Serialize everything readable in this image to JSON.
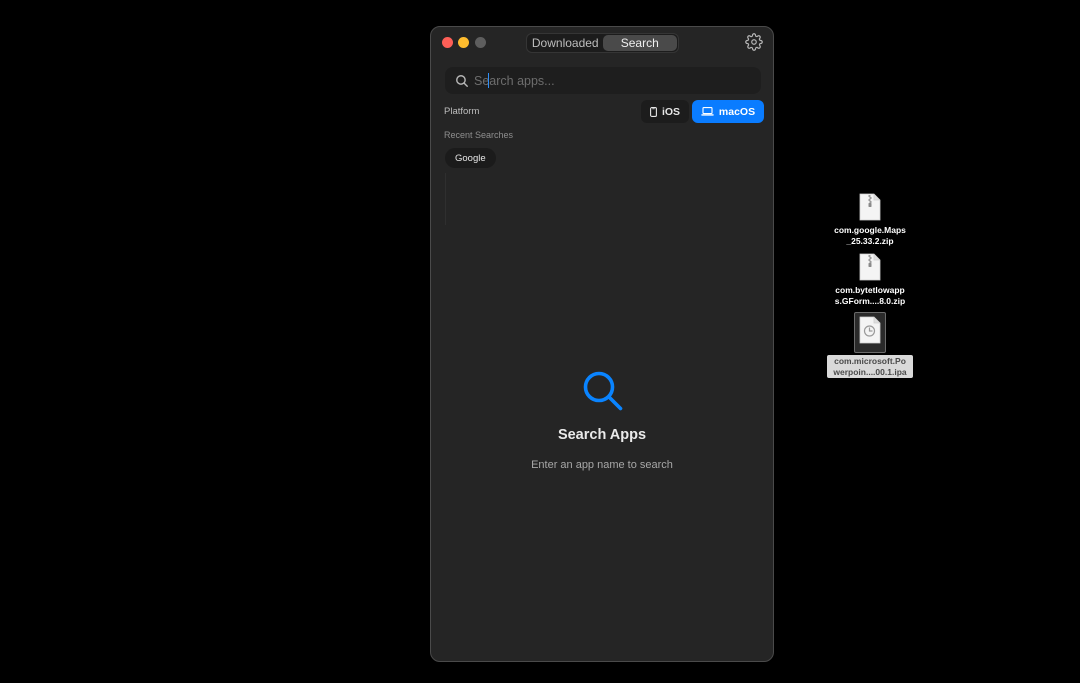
{
  "window": {
    "tabs": [
      {
        "label": "Downloaded",
        "active": false
      },
      {
        "label": "Search",
        "active": true
      }
    ]
  },
  "search": {
    "placeholder": "Search apps...",
    "value": ""
  },
  "platform": {
    "label": "Platform",
    "options": [
      {
        "label": "iOS",
        "icon": "phone-icon",
        "selected": false
      },
      {
        "label": "macOS",
        "icon": "laptop-icon",
        "selected": true
      }
    ],
    "accent": "#0a7cff"
  },
  "recent": {
    "label": "Recent Searches",
    "items": [
      "Google"
    ]
  },
  "empty_state": {
    "icon": "magnifier-icon",
    "title": "Search Apps",
    "subtitle": "Enter an app name to search"
  },
  "desktop_files": [
    {
      "name": "com.google.Maps_25.33.2.zip",
      "line1": "com.google.Maps",
      "line2": "_25.33.2.zip",
      "icon": "zip-file-icon",
      "selected": false
    },
    {
      "name": "com.bytetlowapps.GForm....8.0.zip",
      "line1": "com.bytetlowapp",
      "line2": "s.GForm....8.0.zip",
      "icon": "zip-file-icon",
      "selected": false
    },
    {
      "name": "com.microsoft.Powerpoin....00.1.ipa",
      "line1": "com.microsoft.Po",
      "line2": "werpoin....00.1.ipa",
      "icon": "ipa-file-icon",
      "selected": true
    }
  ]
}
